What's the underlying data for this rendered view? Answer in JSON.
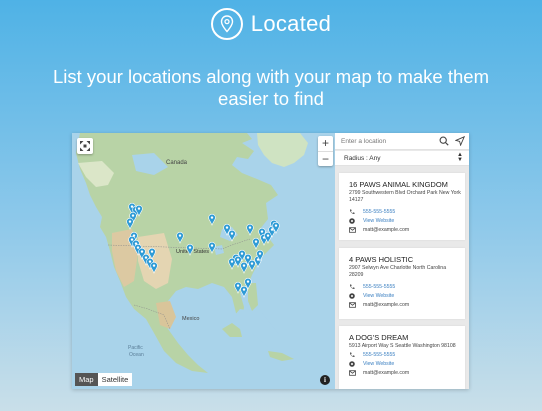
{
  "brand": {
    "title": "Located"
  },
  "headline": "List your locations along with your map to make them easier to find",
  "map": {
    "labels": {
      "canada": "Canada",
      "united_states": "United States",
      "mexico": "Mexico",
      "pacific": "Pacific",
      "ocean": "Ocean"
    },
    "map_type_map": "Map",
    "map_type_satellite": "Satellite",
    "selected_map_type": "Map",
    "zoom_in": "+",
    "zoom_out": "−",
    "info": "i",
    "marker_color": "#2f9bd6"
  },
  "search": {
    "placeholder": "Enter a location",
    "radius_label": "Radius : Any"
  },
  "locations": [
    {
      "name": "16 PAWS ANIMAL KINGDOM",
      "address": "2799 Southwestern Blvd Orchard Park New York 14127",
      "phone": "555-555-5555",
      "website": "View Website",
      "email": "matt@example.com"
    },
    {
      "name": "4 PAWS HOLISTIC",
      "address": "2907 Selwyn Ave Charlotte North Carolina 28209",
      "phone": "555-555-5555",
      "website": "View Website",
      "email": "matt@example.com"
    },
    {
      "name": "A DOG'S DREAM",
      "address": "5913 Airport Way S Seattle Washington 98108",
      "phone": "555-555-5555",
      "website": "View Website",
      "email": "matt@example.com"
    }
  ]
}
